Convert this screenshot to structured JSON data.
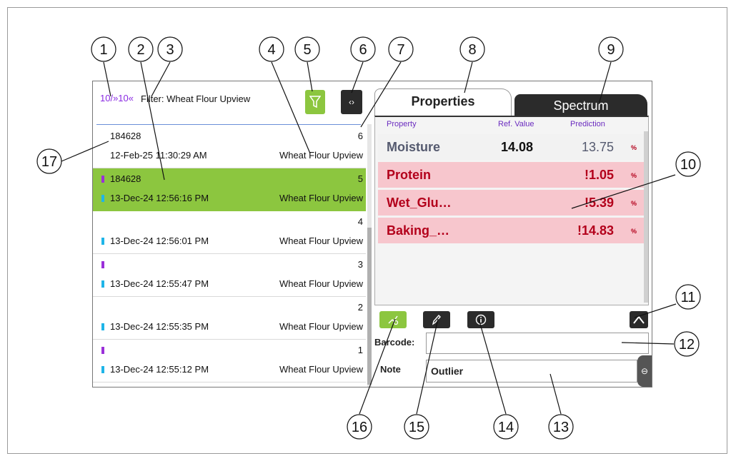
{
  "header": {
    "counter": "10/»10«",
    "filter": "Filter: Wheat Flour Upview",
    "nav_glyph": "‹›"
  },
  "samples": [
    {
      "id": "184628",
      "num": "6",
      "date": "12-Feb-25 11:30:29 AM",
      "product": "Wheat Flour Upview",
      "selected": false,
      "purple": false,
      "blue": false
    },
    {
      "id": "184628",
      "num": "5",
      "date": "13-Dec-24 12:56:16 PM",
      "product": "Wheat Flour Upview",
      "selected": true,
      "purple": true,
      "blue": true
    },
    {
      "id": "",
      "num": "4",
      "date": "13-Dec-24 12:56:01 PM",
      "product": "Wheat Flour Upview",
      "selected": false,
      "purple": false,
      "blue": true
    },
    {
      "id": "",
      "num": "3",
      "date": "13-Dec-24 12:55:47 PM",
      "product": "Wheat Flour Upview",
      "selected": false,
      "purple": true,
      "blue": true
    },
    {
      "id": "",
      "num": "2",
      "date": "13-Dec-24 12:55:35 PM",
      "product": "Wheat Flour Upview",
      "selected": false,
      "purple": false,
      "blue": true
    },
    {
      "id": "",
      "num": "1",
      "date": "13-Dec-24 12:55:12 PM",
      "product": "Wheat Flour Upview",
      "selected": false,
      "purple": true,
      "blue": true
    }
  ],
  "tabs": {
    "properties": "Properties",
    "spectrum": "Spectrum"
  },
  "properties_table": {
    "headers": {
      "property": "Property",
      "ref": "Ref. Value",
      "prediction": "Prediction"
    },
    "rows": [
      {
        "name": "Moisture",
        "ref": "14.08",
        "prediction": "13.75",
        "unit": "%",
        "warning": false
      },
      {
        "name": "Protein",
        "ref": "",
        "prediction": "!1.05",
        "unit": "%",
        "warning": true
      },
      {
        "name": "Wet_Glu…",
        "ref": "",
        "prediction": "!5.39",
        "unit": "%",
        "warning": true
      },
      {
        "name": "Baking_…",
        "ref": "",
        "prediction": "!14.83",
        "unit": "%",
        "warning": true
      }
    ]
  },
  "form": {
    "barcode_label": "Barcode:",
    "barcode_value": "",
    "note_label": "Note",
    "note_value": "Outlier",
    "side_glyph": "⊖"
  },
  "icons": {
    "filter": "funnel-icon",
    "nav": "code-arrows-icon",
    "tool_1": "reference-values-icon",
    "tool_2": "pencil-icon",
    "tool_3": "info-icon",
    "collapse": "collapse-icon"
  },
  "colors": {
    "accent_green": "#8cc63f",
    "dark_button": "#2b2b2b",
    "warning_row": "#f7c6cd",
    "warning_text": "#b3001b",
    "marker_purple": "#9b30d9",
    "marker_blue": "#1fb5e8"
  },
  "callouts": [
    {
      "n": "1"
    },
    {
      "n": "2"
    },
    {
      "n": "3"
    },
    {
      "n": "4"
    },
    {
      "n": "5"
    },
    {
      "n": "6"
    },
    {
      "n": "7"
    },
    {
      "n": "8"
    },
    {
      "n": "9"
    },
    {
      "n": "10"
    },
    {
      "n": "11"
    },
    {
      "n": "12"
    },
    {
      "n": "13"
    },
    {
      "n": "14"
    },
    {
      "n": "15"
    },
    {
      "n": "16"
    },
    {
      "n": "17"
    }
  ]
}
